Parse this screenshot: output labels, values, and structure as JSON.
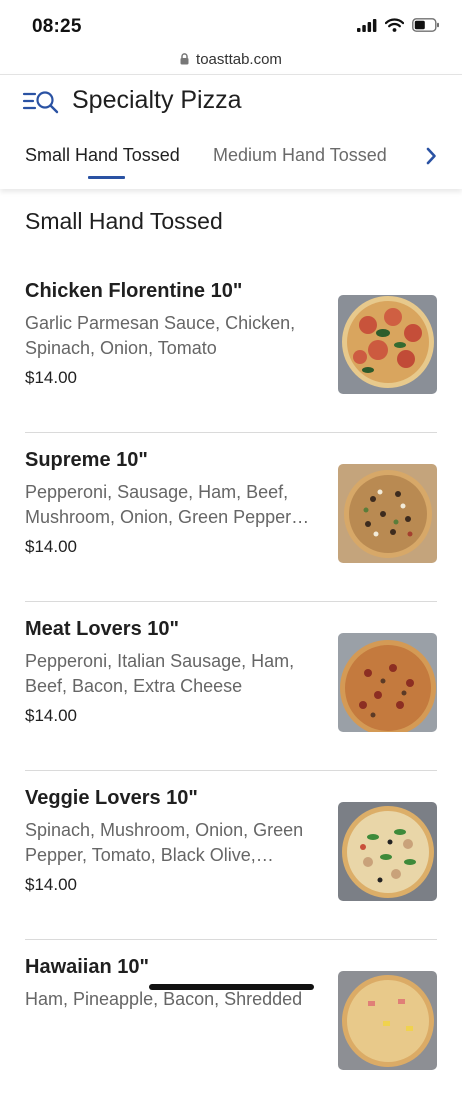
{
  "status_bar": {
    "time": "08:25"
  },
  "browser": {
    "url": "toasttab.com"
  },
  "header": {
    "title": "Specialty Pizza",
    "tabs": [
      {
        "label": "Small Hand Tossed",
        "active": true
      },
      {
        "label": "Medium Hand Tossed",
        "active": false
      }
    ]
  },
  "section": {
    "title": "Small Hand Tossed",
    "items": [
      {
        "name": "Chicken Florentine 10\"",
        "desc_line1": "Garlic Parmesan Sauce, Chicken,",
        "desc_line2": "Spinach, Onion, Tomato",
        "price": "$14.00"
      },
      {
        "name": "Supreme 10\"",
        "desc_line1": "Pepperoni, Sausage, Ham, Beef,",
        "desc_line2": "Mushroom, Onion, Green Pepper…",
        "price": "$14.00"
      },
      {
        "name": "Meat Lovers 10\"",
        "desc_line1": "Pepperoni, Italian Sausage, Ham,",
        "desc_line2": "Beef, Bacon, Extra Cheese",
        "price": "$14.00"
      },
      {
        "name": "Veggie Lovers 10\"",
        "desc_line1": "Spinach, Mushroom, Onion, Green",
        "desc_line2": "Pepper, Tomato, Black Olive,…",
        "price": "$14.00"
      },
      {
        "name": "Hawaiian 10\"",
        "desc_line1": "Ham, Pineapple, Bacon, Shredded",
        "desc_line2": "",
        "price": ""
      }
    ]
  },
  "colors": {
    "accent": "#2a52a3",
    "muted_text": "#666666",
    "divider": "#dadada"
  }
}
